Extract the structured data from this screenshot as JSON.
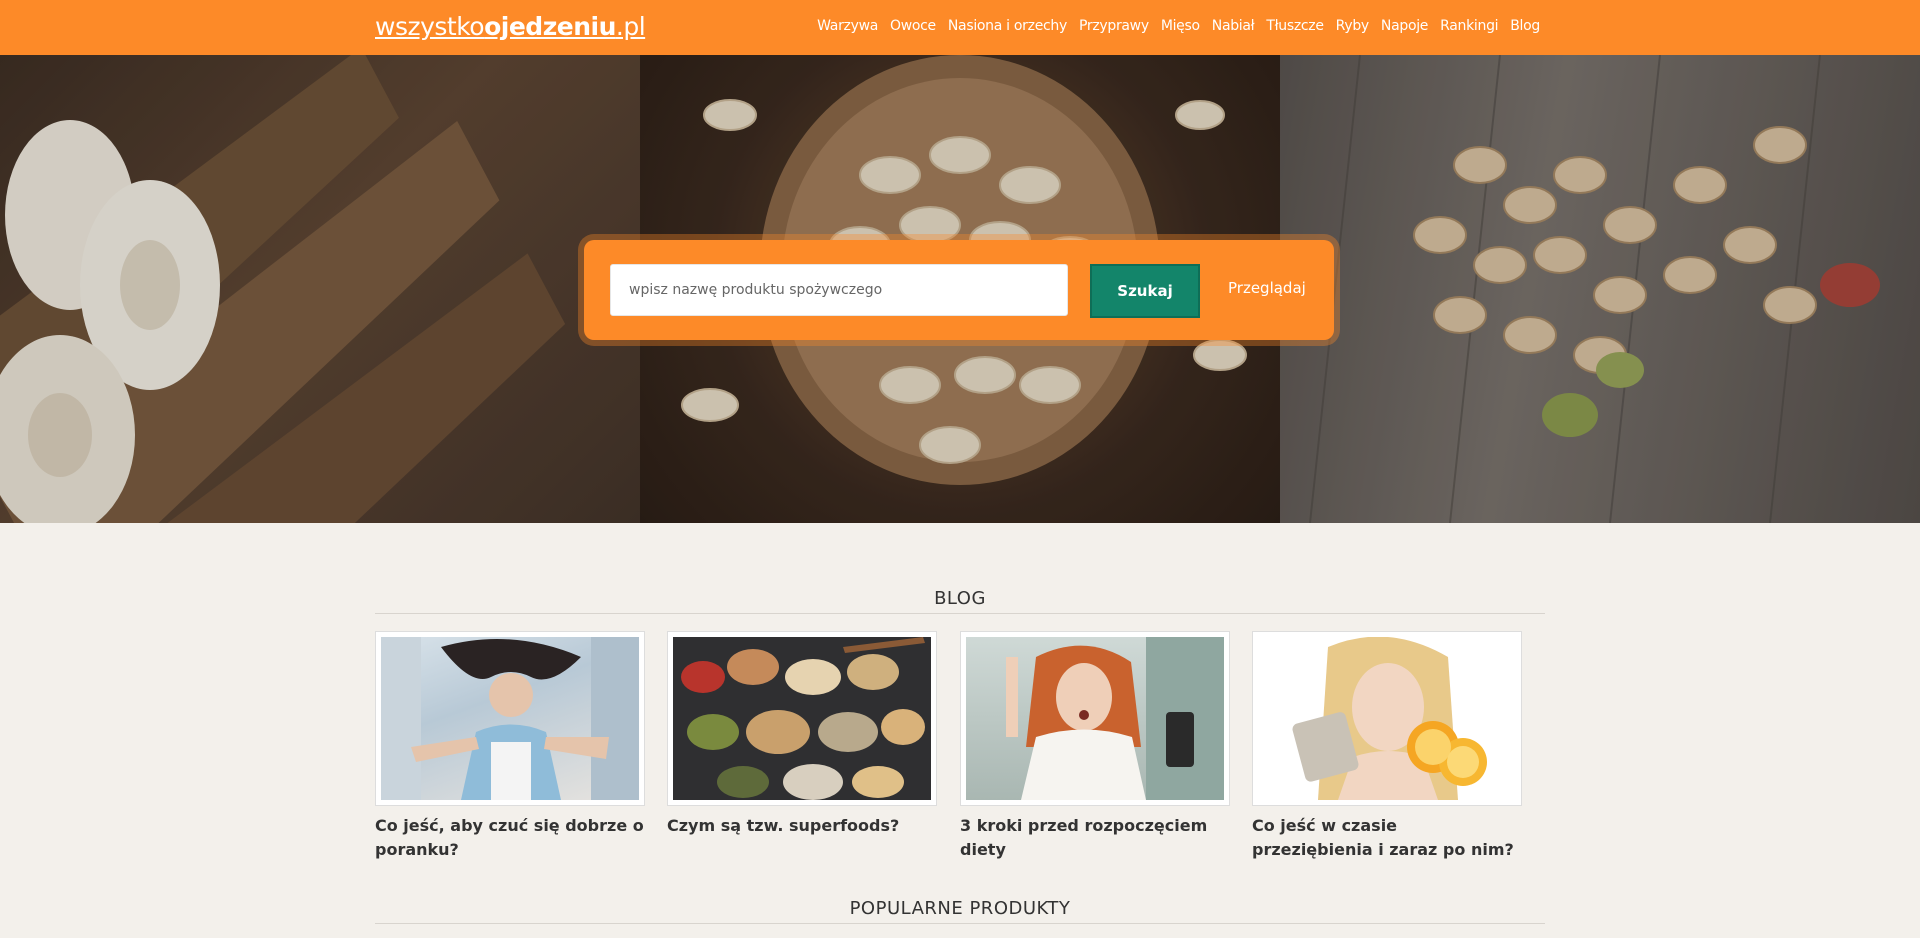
{
  "header": {
    "logo": {
      "prefix": "wszystko",
      "bold": "ojedzeniu",
      "suffix": ".pl"
    },
    "nav": [
      "Warzywa",
      "Owoce",
      "Nasiona i orzechy",
      "Przyprawy",
      "Mięso",
      "Nabiał",
      "Tłuszcze",
      "Ryby",
      "Napoje",
      "Rankingi",
      "Blog"
    ]
  },
  "search": {
    "placeholder": "wpisz nazwę produktu spożywczego",
    "button_label": "Szukaj",
    "browse_label": "Przeglądaj"
  },
  "blog": {
    "title": "BLOG",
    "posts": [
      {
        "title": "Co jeść, aby czuć się dobrze o poranku?"
      },
      {
        "title": "Czym są tzw. superfoods?"
      },
      {
        "title": "3 kroki przed rozpoczęciem diety"
      },
      {
        "title": "Co jeść w czasie przeziębienia i zaraz po nim?"
      }
    ]
  },
  "popular": {
    "title": "POPULARNE PRODUKTY"
  },
  "colors": {
    "brand": "#fd8a28",
    "button": "#13856a",
    "background": "#f3f0eb"
  }
}
